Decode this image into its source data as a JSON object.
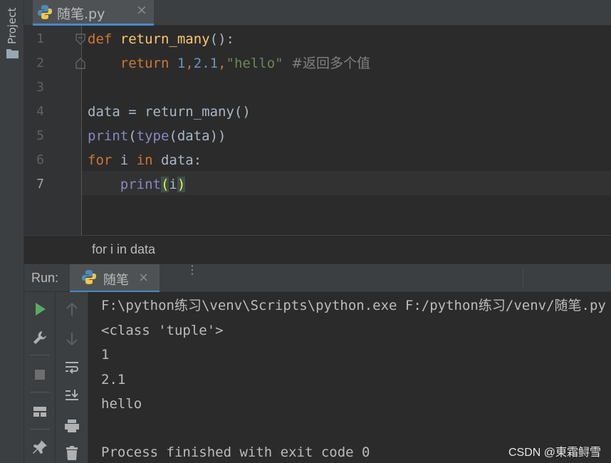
{
  "sidebar": {
    "project_label": "Project"
  },
  "editor_tab": {
    "title": "随笔.py",
    "close": "×"
  },
  "editor": {
    "line_numbers": [
      "1",
      "2",
      "3",
      "4",
      "5",
      "6",
      "7"
    ],
    "lines": {
      "l1": {
        "def": "def",
        "name": "return_many",
        "rest": "():"
      },
      "l2": {
        "indent": "    ",
        "ret": "return",
        "sp1": " ",
        "n1": "1",
        "c1": ",",
        "n2": "2.1",
        "c2": ",",
        "s": "\"hello\"",
        "sp2": " ",
        "cmt": "#返回多个值"
      },
      "l4": {
        "text": "data = return_many()"
      },
      "l5": {
        "print": "print",
        "p1": "(",
        "type": "type",
        "rest": "(data))"
      },
      "l6": {
        "for": "for",
        "mid": " i ",
        "in": "in",
        "rest": " data:"
      },
      "l7": {
        "indent": "    ",
        "print": "print",
        "lp": "(",
        "arg": "i",
        "rp": ")"
      }
    }
  },
  "breadcrumb": {
    "text": "for i in data"
  },
  "run_panel": {
    "label": "Run:",
    "tab_title": "随笔",
    "tab_close": "×",
    "menu": "⋮"
  },
  "console": {
    "lines": [
      "F:\\python练习\\venv\\Scripts\\python.exe F:/python练习/venv/随笔.py",
      "<class 'tuple'>",
      "1",
      "2.1",
      "hello",
      "",
      "Process finished with exit code 0"
    ]
  },
  "watermark": "CSDN @東霜鲟雪",
  "colors": {
    "background": "#2b2b2b",
    "keyword": "#cc7832",
    "function": "#ffc66d",
    "number": "#6897bb",
    "string": "#6a8759",
    "comment": "#808080",
    "builtin": "#8888c6",
    "accent": "#4a88c7"
  }
}
